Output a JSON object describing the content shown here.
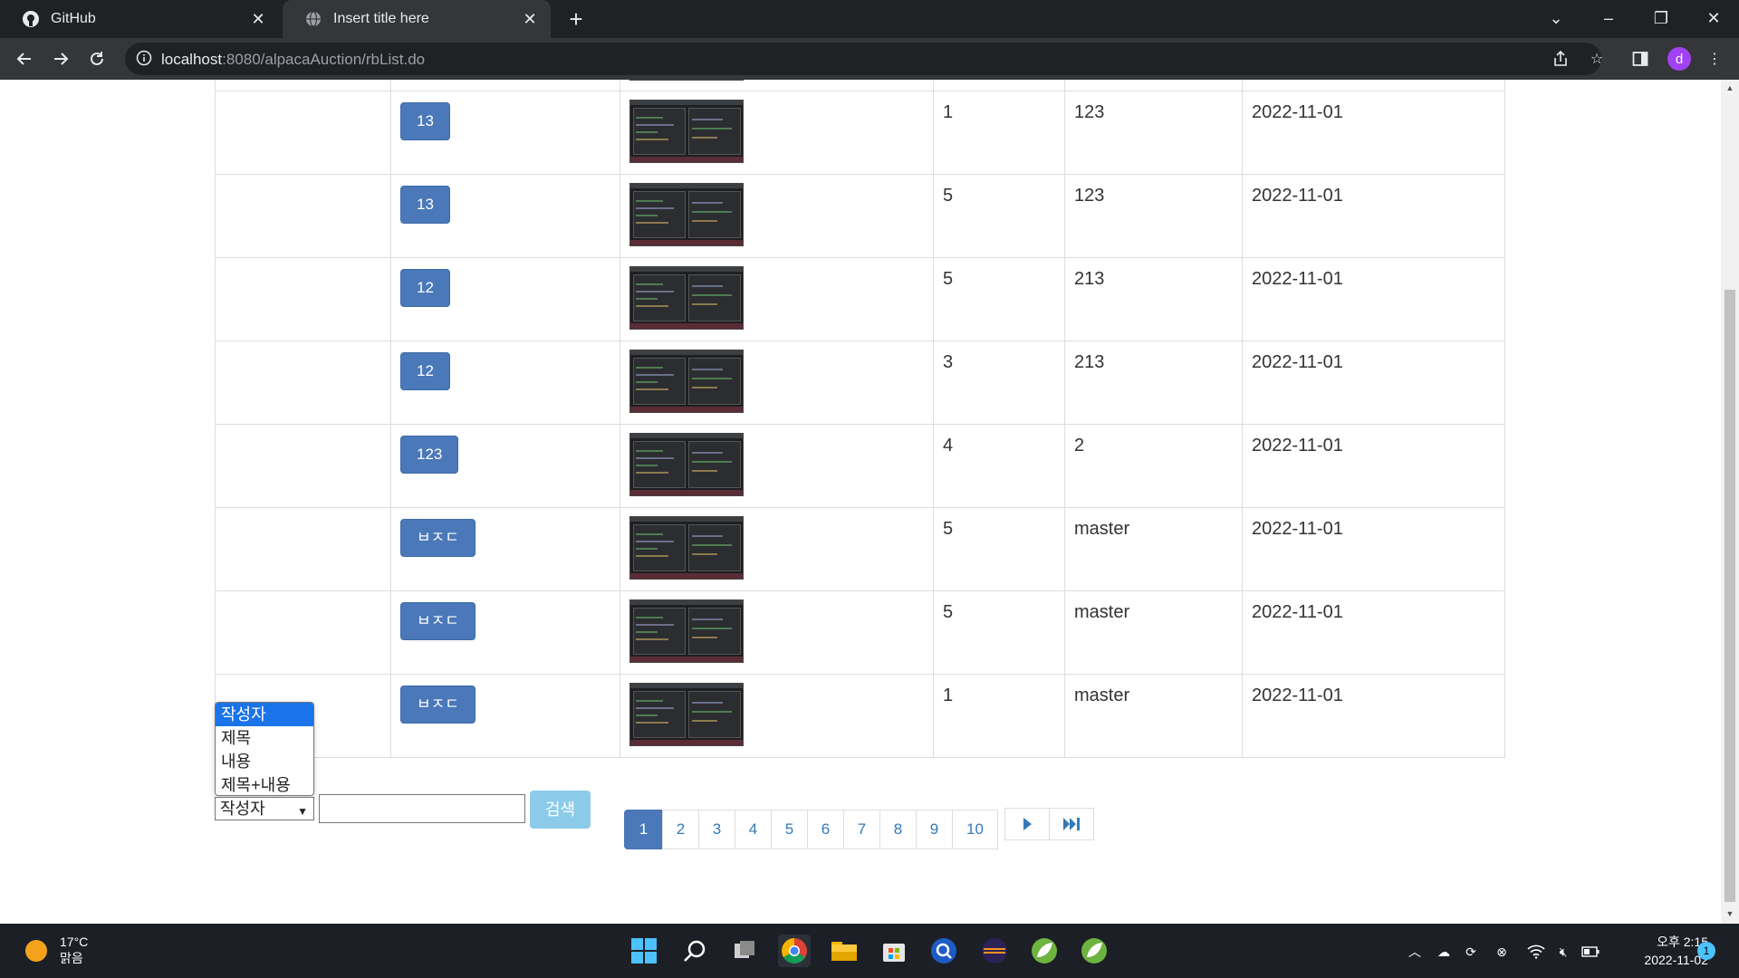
{
  "browser": {
    "tabs": [
      {
        "label": "GitHub"
      },
      {
        "label": "Insert title here"
      }
    ],
    "url_host": "localhost",
    "url_path": ":8080/alpacaAuction/rbList.do"
  },
  "table": {
    "rows": [
      {
        "button": "13",
        "col4": "1",
        "col5": "123",
        "date": "2022-11-01"
      },
      {
        "button": "13",
        "col4": "5",
        "col5": "123",
        "date": "2022-11-01"
      },
      {
        "button": "12",
        "col4": "5",
        "col5": "213",
        "date": "2022-11-01"
      },
      {
        "button": "12",
        "col4": "3",
        "col5": "213",
        "date": "2022-11-01"
      },
      {
        "button": "123",
        "col4": "4",
        "col5": "2",
        "date": "2022-11-01"
      },
      {
        "button": "ㅂㅈㄷ",
        "col4": "5",
        "col5": "master",
        "date": "2022-11-01"
      },
      {
        "button": "ㅂㅈㄷ",
        "col4": "5",
        "col5": "master",
        "date": "2022-11-01"
      },
      {
        "button": "ㅂㅈㄷ",
        "col4": "1",
        "col5": "master",
        "date": "2022-11-01"
      }
    ]
  },
  "search": {
    "options": [
      "작성자",
      "제목",
      "내용",
      "제목+내용"
    ],
    "selected": "작성자",
    "button": "검색",
    "input_value": ""
  },
  "pagination": {
    "pages": [
      "1",
      "2",
      "3",
      "4",
      "5",
      "6",
      "7",
      "8",
      "9",
      "10"
    ],
    "active": "1"
  },
  "taskbar": {
    "weather_temp": "17°C",
    "weather_desc": "맑음",
    "time": "오후 2:15",
    "date": "2022-11-02",
    "notification_count": "1",
    "profile_initial": "d"
  }
}
